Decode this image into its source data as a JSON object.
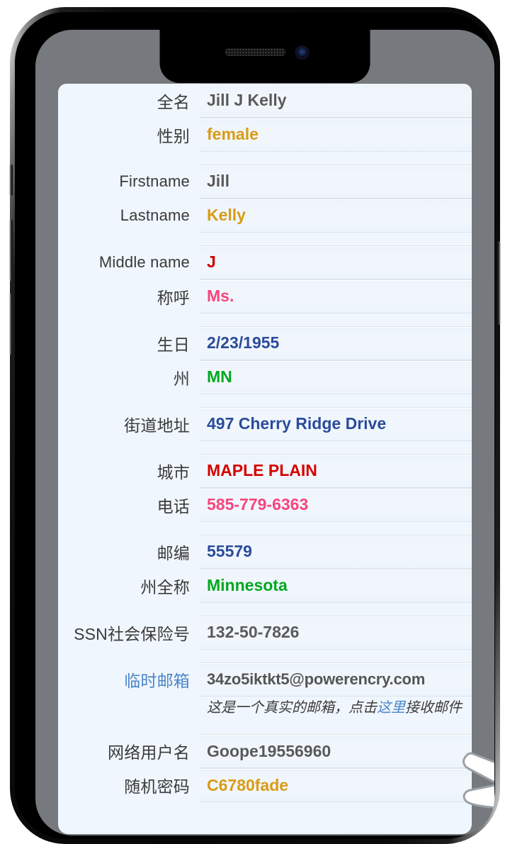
{
  "device": {
    "notch_icons": [
      "speaker-grille",
      "front-camera"
    ],
    "buttons": [
      "volume-up",
      "volume-down",
      "power"
    ]
  },
  "colors": {
    "bezel": "#76797d",
    "panel_bg": "#f0f6fd",
    "link": "#4a86c8",
    "gold": "#d99b16",
    "red": "#cc0000",
    "crimson": "#d40000",
    "pink": "#f8447e",
    "navy": "#2b4b9b",
    "green": "#00a820",
    "gray": "#5a5a5a"
  },
  "form": {
    "groups": [
      {
        "rows": [
          {
            "label": "全名",
            "label_cjk": true,
            "value": "Jill J Kelly",
            "color": "#5a5a5a",
            "name": "fullname"
          },
          {
            "label": "性别",
            "label_cjk": true,
            "value": "female",
            "color": "#d99b16",
            "name": "gender"
          }
        ]
      },
      {
        "rows": [
          {
            "label": "Firstname",
            "label_cjk": false,
            "value": "Jill",
            "color": "#5a5a5a",
            "name": "firstname"
          },
          {
            "label": "Lastname",
            "label_cjk": false,
            "value": "Kelly",
            "color": "#d99b16",
            "name": "lastname"
          }
        ]
      },
      {
        "rows": [
          {
            "label": "Middle name",
            "label_cjk": false,
            "value": "J",
            "color": "#cc0000",
            "name": "middlename"
          },
          {
            "label": "称呼",
            "label_cjk": true,
            "value": "Ms.",
            "color": "#f8447e",
            "name": "salutation"
          }
        ]
      },
      {
        "rows": [
          {
            "label": "生日",
            "label_cjk": true,
            "value": "2/23/1955",
            "color": "#2b4b9b",
            "name": "birthday"
          },
          {
            "label": "州",
            "label_cjk": true,
            "value": "MN",
            "color": "#00a820",
            "name": "state-abbr"
          }
        ]
      },
      {
        "rows": [
          {
            "label": "街道地址",
            "label_cjk": true,
            "value": "497 Cherry Ridge Drive",
            "color": "#2b4b9b",
            "name": "street-address"
          }
        ]
      },
      {
        "rows": [
          {
            "label": "城市",
            "label_cjk": true,
            "value": "MAPLE PLAIN",
            "color": "#d40000",
            "name": "city"
          },
          {
            "label": "电话",
            "label_cjk": true,
            "value": "585-779-6363",
            "color": "#f8447e",
            "name": "phone"
          }
        ]
      },
      {
        "rows": [
          {
            "label": "邮编",
            "label_cjk": true,
            "value": "55579",
            "color": "#2b4b9b",
            "name": "zipcode"
          },
          {
            "label": "州全称",
            "label_cjk": true,
            "value": "Minnesota",
            "color": "#00a820",
            "name": "state-full"
          }
        ]
      },
      {
        "rows": [
          {
            "label": "SSN社会保险号",
            "label_cjk": true,
            "value": "132-50-7826",
            "color": "#5a5a5a",
            "name": "ssn"
          }
        ]
      }
    ],
    "email_row": {
      "label": "临时邮箱",
      "value": "34zo5iktkt5@powerencry.com",
      "name": "temp-email"
    },
    "email_hint": {
      "before": "这是一个真实的邮箱，点击",
      "link": "这里",
      "after": "接收邮件"
    },
    "account_rows": [
      {
        "label": "网络用户名",
        "value": "Goope19556960",
        "color": "#5a5a5a",
        "name": "web-username"
      },
      {
        "label": "随机密码",
        "value": "C6780fade",
        "color": "#d99b16",
        "name": "random-password"
      }
    ]
  }
}
